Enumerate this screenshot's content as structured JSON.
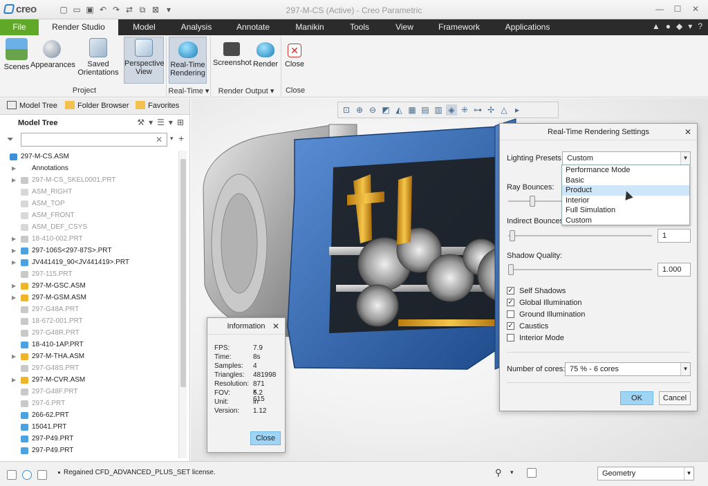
{
  "titlebar": {
    "logo": "creo",
    "window_title": "297-M-CS (Active) - Creo Parametric"
  },
  "tabs": [
    "File",
    "Render Studio",
    "Model",
    "Analysis",
    "Annotate",
    "Manikin",
    "Tools",
    "View",
    "Framework",
    "Applications"
  ],
  "ribbon": {
    "buttons": {
      "scenes": "Scenes",
      "appearances": "Appearances",
      "saved_orientations_1": "Saved",
      "saved_orientations_2": "Orientations",
      "perspective_1": "Perspective",
      "perspective_2": "View",
      "realtime_1": "Real-Time",
      "realtime_2": "Rendering",
      "screenshot": "Screenshot",
      "render": "Render",
      "close": "Close"
    },
    "groups": {
      "project": "Project",
      "realtime": "Real-Time",
      "render_output": "Render Output",
      "close": "Close"
    }
  },
  "left_panel": {
    "tabs": [
      "Model Tree",
      "Folder Browser",
      "Favorites"
    ],
    "tree_title": "Model Tree",
    "tree": [
      {
        "label": "297-M-CS.ASM",
        "dim": false,
        "root": true,
        "exp": "",
        "color": "#3a8fd8"
      },
      {
        "label": "Annotations",
        "dim": false,
        "root": false,
        "exp": "▶",
        "color": "none"
      },
      {
        "label": "297-M-CS_SKEL0001.PRT",
        "dim": true,
        "root": false,
        "exp": "▶",
        "color": "#c9c9c9"
      },
      {
        "label": "ASM_RIGHT",
        "dim": true,
        "root": false,
        "exp": "",
        "color": "#d8d8d8"
      },
      {
        "label": "ASM_TOP",
        "dim": true,
        "root": false,
        "exp": "",
        "color": "#d8d8d8"
      },
      {
        "label": "ASM_FRONT",
        "dim": true,
        "root": false,
        "exp": "",
        "color": "#d8d8d8"
      },
      {
        "label": "ASM_DEF_CSYS",
        "dim": true,
        "root": false,
        "exp": "",
        "color": "#d8d8d8"
      },
      {
        "label": "18-410-002.PRT",
        "dim": true,
        "root": false,
        "exp": "▶",
        "color": "#c9c9c9"
      },
      {
        "label": "297-106S<297-87S>.PRT",
        "dim": false,
        "root": false,
        "exp": "▶",
        "color": "#4aa3e0"
      },
      {
        "label": "JV441419_90<JV441419>.PRT",
        "dim": false,
        "root": false,
        "exp": "▶",
        "color": "#4aa3e0"
      },
      {
        "label": "297-115.PRT",
        "dim": true,
        "root": false,
        "exp": "",
        "color": "#c9c9c9"
      },
      {
        "label": "297-M-GSC.ASM",
        "dim": false,
        "root": false,
        "exp": "▶",
        "color": "#f0b429"
      },
      {
        "label": "297-M-GSM.ASM",
        "dim": false,
        "root": false,
        "exp": "▶",
        "color": "#f0b429"
      },
      {
        "label": "297-G48A.PRT",
        "dim": true,
        "root": false,
        "exp": "",
        "color": "#c9c9c9"
      },
      {
        "label": "18-672-001.PRT",
        "dim": true,
        "root": false,
        "exp": "",
        "color": "#c9c9c9"
      },
      {
        "label": "297-G48R.PRT",
        "dim": true,
        "root": false,
        "exp": "",
        "color": "#c9c9c9"
      },
      {
        "label": "18-410-1AP.PRT",
        "dim": false,
        "root": false,
        "exp": "",
        "color": "#4aa3e0"
      },
      {
        "label": "297-M-THA.ASM",
        "dim": false,
        "root": false,
        "exp": "▶",
        "color": "#f0b429"
      },
      {
        "label": "297-G48S.PRT",
        "dim": true,
        "root": false,
        "exp": "",
        "color": "#c9c9c9"
      },
      {
        "label": "297-M-CVR.ASM",
        "dim": false,
        "root": false,
        "exp": "▶",
        "color": "#f0b429"
      },
      {
        "label": "297-G48F.PRT",
        "dim": true,
        "root": false,
        "exp": "",
        "color": "#c9c9c9"
      },
      {
        "label": "297-6.PRT",
        "dim": true,
        "root": false,
        "exp": "",
        "color": "#c9c9c9"
      },
      {
        "label": "266-62.PRT",
        "dim": false,
        "root": false,
        "exp": "",
        "color": "#4aa3e0"
      },
      {
        "label": "15041.PRT",
        "dim": false,
        "root": false,
        "exp": "",
        "color": "#4aa3e0"
      },
      {
        "label": "297-P49.PRT",
        "dim": false,
        "root": false,
        "exp": "",
        "color": "#4aa3e0"
      },
      {
        "label": "297-P49.PRT",
        "dim": false,
        "root": false,
        "exp": "",
        "color": "#4aa3e0"
      }
    ]
  },
  "info_dialog": {
    "title": "Information",
    "rows": [
      {
        "k": "FPS:",
        "v": "7.9"
      },
      {
        "k": "Time:",
        "v": "8s"
      },
      {
        "k": "Samples:",
        "v": "4"
      },
      {
        "k": "Triangles:",
        "v": "481998"
      },
      {
        "k": "Resolution:",
        "v": "871 x 615"
      },
      {
        "k": "FOV:",
        "v": "6.2"
      },
      {
        "k": "Unit:",
        "v": "in"
      },
      {
        "k": "Version:",
        "v": "1.12"
      }
    ],
    "close_label": "Close"
  },
  "rtr_dialog": {
    "title": "Real-Time Rendering Settings",
    "lighting_label": "Lighting Presets:",
    "lighting_value": "Custom",
    "presets": [
      "Performance Mode",
      "Basic",
      "Product",
      "Interior",
      "Full Simulation",
      "Custom"
    ],
    "selected_preset": "Product",
    "ray_bounces_label": "Ray Bounces:",
    "indirect_label": "Indirect Bounces:",
    "indirect_value": "1",
    "shadow_label": "Shadow Quality:",
    "shadow_value": "1.000",
    "checks": [
      {
        "label": "Self Shadows",
        "checked": true
      },
      {
        "label": "Global Illumination",
        "checked": true
      },
      {
        "label": "Ground Illumination",
        "checked": false
      },
      {
        "label": "Caustics",
        "checked": true
      },
      {
        "label": "Interior Mode",
        "checked": false
      }
    ],
    "cores_label": "Number of cores:",
    "cores_value": "75 % - 6 cores",
    "ok_label": "OK",
    "cancel_label": "Cancel"
  },
  "status": {
    "message": "Regained CFD_ADVANCED_PLUS_SET license.",
    "filter_value": "Geometry"
  },
  "colors": {
    "file_tab": "#5fa828",
    "tab_bar": "#2b2b2b",
    "primary_button": "#9fd4f4",
    "housing_blue": "#2e62a8"
  }
}
